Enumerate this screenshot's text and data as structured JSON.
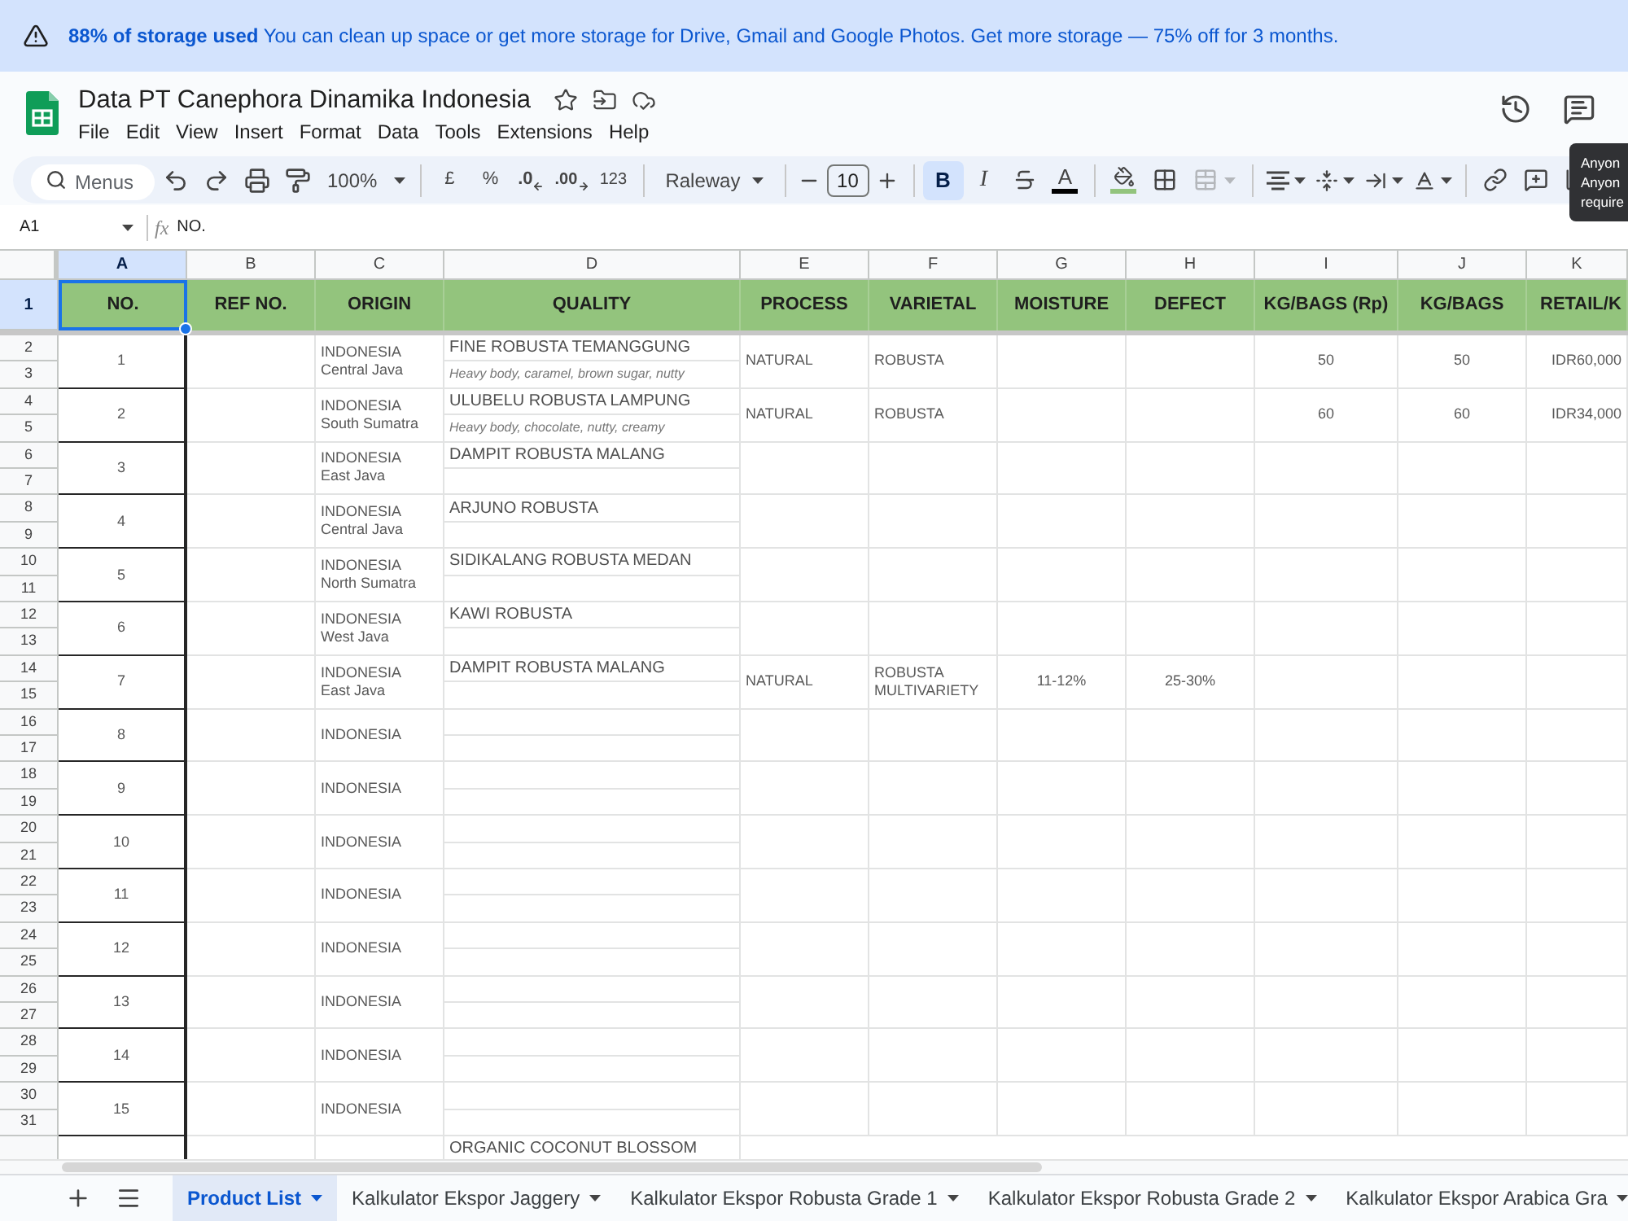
{
  "banner": {
    "text": "**88% of storage used** You can clean up space or get more storage for Drive, Gmail and Google Photos. Get more storage — 75% off for 3 months."
  },
  "document": {
    "title": "Data PT Canephora Dinamika Indonesia",
    "menu": [
      "File",
      "Edit",
      "View",
      "Insert",
      "Format",
      "Data",
      "Tools",
      "Extensions",
      "Help"
    ]
  },
  "toolbar": {
    "search": {
      "placeholder": "Menus"
    },
    "zoom": "100%",
    "currency": "£",
    "percent": "%",
    "decrease_decimal": ".0",
    "increase_decimal": ".00",
    "number_format": "123",
    "font": "Raleway",
    "font_size": "10",
    "bold": {
      "label": "B",
      "on": true
    },
    "italic": {
      "label": "I",
      "on": false
    },
    "text_color": {
      "label": "A"
    },
    "merge": {
      "disabled": true
    }
  },
  "tooltip": {
    "lines": [
      "Anyon",
      "Anyon",
      "require"
    ]
  },
  "formula_bar": {
    "cell": "A1",
    "fx": "fx",
    "formula": "NO."
  },
  "columns": [
    {
      "letter": "A",
      "selected": true
    },
    {
      "letter": "B",
      "selected": false
    },
    {
      "letter": "C",
      "selected": false
    },
    {
      "letter": "D",
      "selected": false
    },
    {
      "letter": "E",
      "selected": false
    },
    {
      "letter": "F",
      "selected": false
    },
    {
      "letter": "G",
      "selected": false
    },
    {
      "letter": "H",
      "selected": false
    },
    {
      "letter": "I",
      "selected": false
    },
    {
      "letter": "J",
      "selected": false
    },
    {
      "letter": "K",
      "selected": false
    }
  ],
  "header_row": {
    "number": "1",
    "selected": true,
    "cells": [
      "NO.",
      "REF NO.",
      "ORIGIN",
      "QUALITY",
      "PROCESS",
      "VARIETAL",
      "MOISTURE",
      "DEFECT",
      "KG/BAGS (Rp)",
      "KG/BAGS",
      "RETAIL/K"
    ]
  },
  "items": [
    {
      "rows": [
        "2",
        "3"
      ],
      "no": "1",
      "origin": "INDONESIA",
      "region": "Central Java",
      "quality": "FINE ROBUSTA TEMANGGUNG",
      "notes": "Heavy body, caramel, brown sugar, nutty",
      "process": "NATURAL",
      "varietal": "ROBUSTA",
      "kg_bags_rp": "50",
      "kg_bags": "50",
      "retail": "IDR60,000"
    },
    {
      "rows": [
        "4",
        "5"
      ],
      "no": "2",
      "origin": "INDONESIA",
      "region": "South Sumatra",
      "quality": "ULUBELU ROBUSTA LAMPUNG",
      "notes": "Heavy body, chocolate, nutty, creamy",
      "process": "NATURAL",
      "varietal": "ROBUSTA",
      "kg_bags_rp": "60",
      "kg_bags": "60",
      "retail": "IDR34,000"
    },
    {
      "rows": [
        "6",
        "7"
      ],
      "no": "3",
      "origin": "INDONESIA",
      "region": "East Java",
      "quality": "DAMPIT ROBUSTA MALANG"
    },
    {
      "rows": [
        "8",
        "9"
      ],
      "no": "4",
      "origin": "INDONESIA",
      "region": "Central Java",
      "quality": "ARJUNO ROBUSTA"
    },
    {
      "rows": [
        "10",
        "11"
      ],
      "no": "5",
      "origin": "INDONESIA",
      "region": "North Sumatra",
      "quality": "SIDIKALANG ROBUSTA MEDAN"
    },
    {
      "rows": [
        "12",
        "13"
      ],
      "no": "6",
      "origin": "INDONESIA",
      "region": "West Java",
      "quality": "KAWI ROBUSTA"
    },
    {
      "rows": [
        "14",
        "15"
      ],
      "no": "7",
      "origin": "INDONESIA",
      "region": "East Java",
      "quality": "DAMPIT ROBUSTA MALANG",
      "process": "NATURAL",
      "varietal": "ROBUSTA MULTIVARIETY",
      "moisture": "11-12%",
      "defect": "25-30%"
    },
    {
      "rows": [
        "16",
        "17"
      ],
      "no": "8",
      "origin": "INDONESIA"
    },
    {
      "rows": [
        "18",
        "19"
      ],
      "no": "9",
      "origin": "INDONESIA"
    },
    {
      "rows": [
        "20",
        "21"
      ],
      "no": "10",
      "origin": "INDONESIA"
    },
    {
      "rows": [
        "22",
        "23"
      ],
      "no": "11",
      "origin": "INDONESIA"
    },
    {
      "rows": [
        "24",
        "25"
      ],
      "no": "12",
      "origin": "INDONESIA"
    },
    {
      "rows": [
        "26",
        "27"
      ],
      "no": "13",
      "origin": "INDONESIA"
    },
    {
      "rows": [
        "28",
        "29"
      ],
      "no": "14",
      "origin": "INDONESIA"
    },
    {
      "rows": [
        "30",
        "31"
      ],
      "no": "15",
      "origin": "INDONESIA"
    }
  ],
  "partial_row": {
    "quality": "ORGANIC COCONUT BLOSSOM"
  },
  "sheet_tabs": [
    {
      "label": "Product List",
      "selected": true
    },
    {
      "label": "Kalkulator Ekspor Jaggery",
      "selected": false
    },
    {
      "label": "Kalkulator Ekspor Robusta Grade 1",
      "selected": false
    },
    {
      "label": "Kalkulator Ekspor Robusta Grade 2",
      "selected": false
    },
    {
      "label": "Kalkulator Ekspor Arabica Gra",
      "selected": false
    }
  ]
}
